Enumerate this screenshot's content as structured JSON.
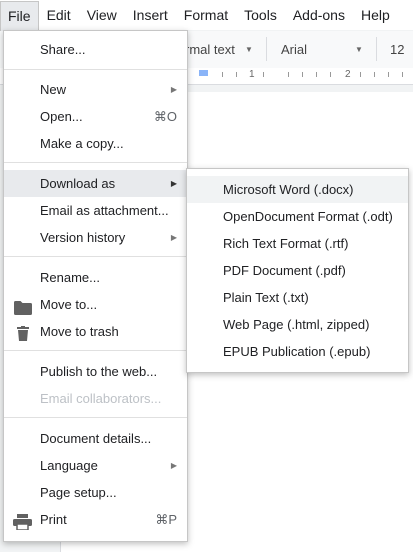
{
  "menubar": {
    "items": [
      "File",
      "Edit",
      "View",
      "Insert",
      "Format",
      "Tools",
      "Add-ons",
      "Help"
    ]
  },
  "toolbar": {
    "style_value": "rmal text",
    "font_value": "Arial",
    "size_value": "12"
  },
  "ruler": {
    "numbers": [
      "1",
      "2"
    ]
  },
  "file_menu": {
    "share": "Share...",
    "new": "New",
    "open": "Open...",
    "open_shortcut": "⌘O",
    "make_copy": "Make a copy...",
    "download_as": "Download as",
    "email_attachment": "Email as attachment...",
    "version_history": "Version history",
    "rename": "Rename...",
    "move_to": "Move to...",
    "move_to_trash": "Move to trash",
    "publish": "Publish to the web...",
    "email_collaborators": "Email collaborators...",
    "document_details": "Document details...",
    "language": "Language",
    "page_setup": "Page setup...",
    "print": "Print",
    "print_shortcut": "⌘P"
  },
  "download_submenu": {
    "items": [
      "Microsoft Word (.docx)",
      "OpenDocument Format (.odt)",
      "Rich Text Format (.rtf)",
      "PDF Document (.pdf)",
      "Plain Text (.txt)",
      "Web Page (.html, zipped)",
      "EPUB Publication (.epub)"
    ]
  }
}
